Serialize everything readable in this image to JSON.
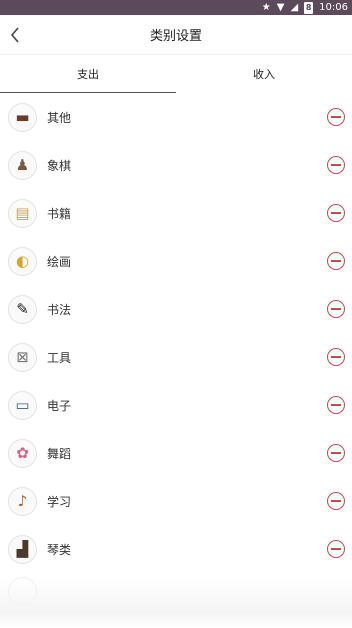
{
  "status_bar": {
    "time": "10:06",
    "battery_level": "8",
    "icons": [
      "star-icon",
      "wifi-icon",
      "signal-off-icon",
      "battery-icon"
    ]
  },
  "header": {
    "title": "类别设置",
    "back_icon": "chevron-left-icon"
  },
  "tabs": [
    {
      "label": "支出",
      "active": true
    },
    {
      "label": "收入",
      "active": false
    }
  ],
  "categories": [
    {
      "label": "其他",
      "icon": "other-icon",
      "glyph": "▬"
    },
    {
      "label": "象棋",
      "icon": "chess-icon",
      "glyph": "♟"
    },
    {
      "label": "书籍",
      "icon": "book-icon",
      "glyph": "▤"
    },
    {
      "label": "绘画",
      "icon": "palette-icon",
      "glyph": "◐"
    },
    {
      "label": "书法",
      "icon": "brush-icon",
      "glyph": "✎"
    },
    {
      "label": "工具",
      "icon": "tools-icon",
      "glyph": "⊠"
    },
    {
      "label": "电子",
      "icon": "computer-icon",
      "glyph": "▭"
    },
    {
      "label": "舞蹈",
      "icon": "dance-icon",
      "glyph": "✿"
    },
    {
      "label": "学习",
      "icon": "violin-icon",
      "glyph": "♪"
    },
    {
      "label": "琴类",
      "icon": "piano-icon",
      "glyph": "▟"
    }
  ],
  "colors": {
    "status_bar": "#5b4a5a",
    "delete": "#c94a4a"
  }
}
